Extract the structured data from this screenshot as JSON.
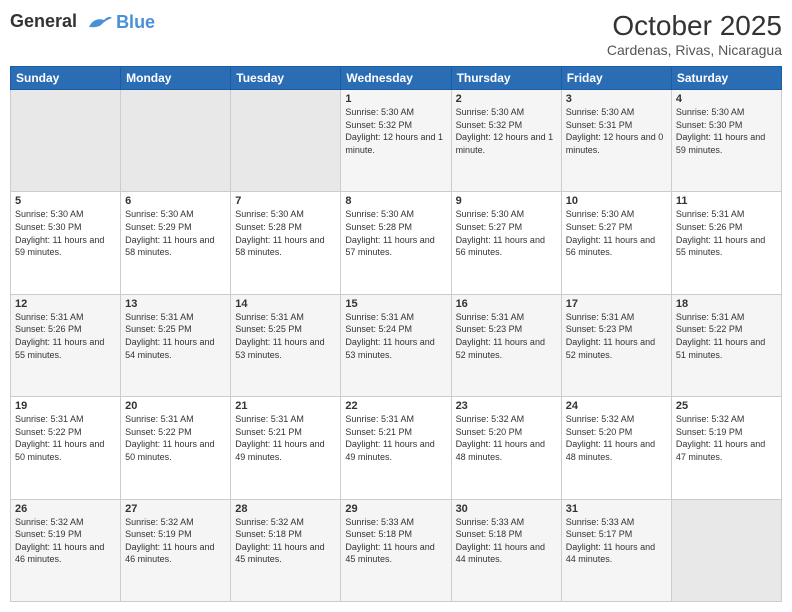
{
  "logo": {
    "line1": "General",
    "line2": "Blue"
  },
  "header": {
    "month": "October 2025",
    "location": "Cardenas, Rivas, Nicaragua"
  },
  "days_of_week": [
    "Sunday",
    "Monday",
    "Tuesday",
    "Wednesday",
    "Thursday",
    "Friday",
    "Saturday"
  ],
  "weeks": [
    [
      {
        "day": "",
        "sunrise": "",
        "sunset": "",
        "daylight": "",
        "empty": true
      },
      {
        "day": "",
        "sunrise": "",
        "sunset": "",
        "daylight": "",
        "empty": true
      },
      {
        "day": "",
        "sunrise": "",
        "sunset": "",
        "daylight": "",
        "empty": true
      },
      {
        "day": "1",
        "sunrise": "Sunrise: 5:30 AM",
        "sunset": "Sunset: 5:32 PM",
        "daylight": "Daylight: 12 hours and 1 minute."
      },
      {
        "day": "2",
        "sunrise": "Sunrise: 5:30 AM",
        "sunset": "Sunset: 5:32 PM",
        "daylight": "Daylight: 12 hours and 1 minute."
      },
      {
        "day": "3",
        "sunrise": "Sunrise: 5:30 AM",
        "sunset": "Sunset: 5:31 PM",
        "daylight": "Daylight: 12 hours and 0 minutes."
      },
      {
        "day": "4",
        "sunrise": "Sunrise: 5:30 AM",
        "sunset": "Sunset: 5:30 PM",
        "daylight": "Daylight: 11 hours and 59 minutes."
      }
    ],
    [
      {
        "day": "5",
        "sunrise": "Sunrise: 5:30 AM",
        "sunset": "Sunset: 5:30 PM",
        "daylight": "Daylight: 11 hours and 59 minutes."
      },
      {
        "day": "6",
        "sunrise": "Sunrise: 5:30 AM",
        "sunset": "Sunset: 5:29 PM",
        "daylight": "Daylight: 11 hours and 58 minutes."
      },
      {
        "day": "7",
        "sunrise": "Sunrise: 5:30 AM",
        "sunset": "Sunset: 5:28 PM",
        "daylight": "Daylight: 11 hours and 58 minutes."
      },
      {
        "day": "8",
        "sunrise": "Sunrise: 5:30 AM",
        "sunset": "Sunset: 5:28 PM",
        "daylight": "Daylight: 11 hours and 57 minutes."
      },
      {
        "day": "9",
        "sunrise": "Sunrise: 5:30 AM",
        "sunset": "Sunset: 5:27 PM",
        "daylight": "Daylight: 11 hours and 56 minutes."
      },
      {
        "day": "10",
        "sunrise": "Sunrise: 5:30 AM",
        "sunset": "Sunset: 5:27 PM",
        "daylight": "Daylight: 11 hours and 56 minutes."
      },
      {
        "day": "11",
        "sunrise": "Sunrise: 5:31 AM",
        "sunset": "Sunset: 5:26 PM",
        "daylight": "Daylight: 11 hours and 55 minutes."
      }
    ],
    [
      {
        "day": "12",
        "sunrise": "Sunrise: 5:31 AM",
        "sunset": "Sunset: 5:26 PM",
        "daylight": "Daylight: 11 hours and 55 minutes."
      },
      {
        "day": "13",
        "sunrise": "Sunrise: 5:31 AM",
        "sunset": "Sunset: 5:25 PM",
        "daylight": "Daylight: 11 hours and 54 minutes."
      },
      {
        "day": "14",
        "sunrise": "Sunrise: 5:31 AM",
        "sunset": "Sunset: 5:25 PM",
        "daylight": "Daylight: 11 hours and 53 minutes."
      },
      {
        "day": "15",
        "sunrise": "Sunrise: 5:31 AM",
        "sunset": "Sunset: 5:24 PM",
        "daylight": "Daylight: 11 hours and 53 minutes."
      },
      {
        "day": "16",
        "sunrise": "Sunrise: 5:31 AM",
        "sunset": "Sunset: 5:23 PM",
        "daylight": "Daylight: 11 hours and 52 minutes."
      },
      {
        "day": "17",
        "sunrise": "Sunrise: 5:31 AM",
        "sunset": "Sunset: 5:23 PM",
        "daylight": "Daylight: 11 hours and 52 minutes."
      },
      {
        "day": "18",
        "sunrise": "Sunrise: 5:31 AM",
        "sunset": "Sunset: 5:22 PM",
        "daylight": "Daylight: 11 hours and 51 minutes."
      }
    ],
    [
      {
        "day": "19",
        "sunrise": "Sunrise: 5:31 AM",
        "sunset": "Sunset: 5:22 PM",
        "daylight": "Daylight: 11 hours and 50 minutes."
      },
      {
        "day": "20",
        "sunrise": "Sunrise: 5:31 AM",
        "sunset": "Sunset: 5:22 PM",
        "daylight": "Daylight: 11 hours and 50 minutes."
      },
      {
        "day": "21",
        "sunrise": "Sunrise: 5:31 AM",
        "sunset": "Sunset: 5:21 PM",
        "daylight": "Daylight: 11 hours and 49 minutes."
      },
      {
        "day": "22",
        "sunrise": "Sunrise: 5:31 AM",
        "sunset": "Sunset: 5:21 PM",
        "daylight": "Daylight: 11 hours and 49 minutes."
      },
      {
        "day": "23",
        "sunrise": "Sunrise: 5:32 AM",
        "sunset": "Sunset: 5:20 PM",
        "daylight": "Daylight: 11 hours and 48 minutes."
      },
      {
        "day": "24",
        "sunrise": "Sunrise: 5:32 AM",
        "sunset": "Sunset: 5:20 PM",
        "daylight": "Daylight: 11 hours and 48 minutes."
      },
      {
        "day": "25",
        "sunrise": "Sunrise: 5:32 AM",
        "sunset": "Sunset: 5:19 PM",
        "daylight": "Daylight: 11 hours and 47 minutes."
      }
    ],
    [
      {
        "day": "26",
        "sunrise": "Sunrise: 5:32 AM",
        "sunset": "Sunset: 5:19 PM",
        "daylight": "Daylight: 11 hours and 46 minutes."
      },
      {
        "day": "27",
        "sunrise": "Sunrise: 5:32 AM",
        "sunset": "Sunset: 5:19 PM",
        "daylight": "Daylight: 11 hours and 46 minutes."
      },
      {
        "day": "28",
        "sunrise": "Sunrise: 5:32 AM",
        "sunset": "Sunset: 5:18 PM",
        "daylight": "Daylight: 11 hours and 45 minutes."
      },
      {
        "day": "29",
        "sunrise": "Sunrise: 5:33 AM",
        "sunset": "Sunset: 5:18 PM",
        "daylight": "Daylight: 11 hours and 45 minutes."
      },
      {
        "day": "30",
        "sunrise": "Sunrise: 5:33 AM",
        "sunset": "Sunset: 5:18 PM",
        "daylight": "Daylight: 11 hours and 44 minutes."
      },
      {
        "day": "31",
        "sunrise": "Sunrise: 5:33 AM",
        "sunset": "Sunset: 5:17 PM",
        "daylight": "Daylight: 11 hours and 44 minutes."
      },
      {
        "day": "",
        "sunrise": "",
        "sunset": "",
        "daylight": "",
        "empty": true
      }
    ]
  ]
}
